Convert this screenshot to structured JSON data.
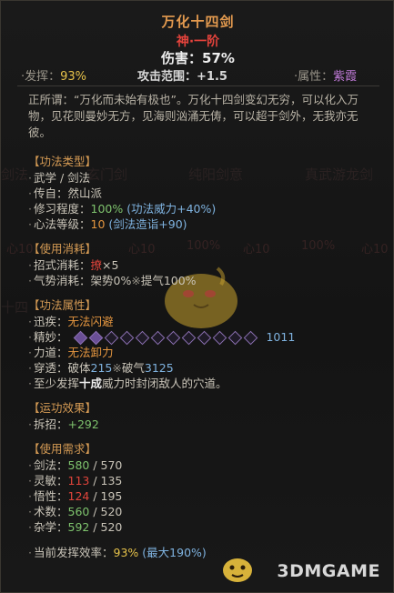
{
  "header": {
    "title": "万化十四剑",
    "rank": "神·一阶",
    "damage_label": "伤害：",
    "damage_value": "57%"
  },
  "stats": {
    "play_label": "·发挥：",
    "play_value": "93%",
    "range_label": "攻击范围：",
    "range_value": "+1.5",
    "attr_label": "·属性：",
    "attr_value": "紫霞"
  },
  "description": "正所谓：“万化而未始有极也”。万化十四剑变幻无穷，可以化入万物，见花则曼妙无方，见海则汹涌无俦，可以超于剑外，无我亦无彼。",
  "sections": {
    "type_title": "【功法类型】",
    "type_rows": [
      {
        "label": "武学 / 剑法",
        "value": ""
      },
      {
        "label": "传自：",
        "value": "然山派"
      },
      {
        "label": "修习程度：",
        "value": "100%",
        "extra": "(功法威力+40%)"
      },
      {
        "label": "心法等级：",
        "value": "10",
        "extra": "(剑法造诣+90)"
      }
    ],
    "cost_title": "【使用消耗】",
    "cost_row1_label": "招式消耗：",
    "cost_row1_icon": "撩",
    "cost_row1_count": "×5",
    "cost_row2_label": "气势消耗：",
    "cost_row2_a": "架势0%",
    "cost_row2_sep": "※",
    "cost_row2_b": "提气100%",
    "prop_title": "【功法属性】",
    "prop_rows": {
      "swift_label": "迅疾：",
      "swift_value": "无法闪避",
      "fine_label": "精妙：",
      "fine_value": "1011",
      "force_label": "力道：",
      "force_value": "无法卸力",
      "pierce_label": "穿透：",
      "pierce_a_label": "破体",
      "pierce_a_value": "215",
      "pierce_sep": "※",
      "pierce_b_label": "破气",
      "pierce_b_value": "3125",
      "note_a": "至少发挥",
      "note_b": "十成",
      "note_c": "威力时封闭敌人的穴道。"
    },
    "effect_title": "【运功效果】",
    "effect_label": "拆招：",
    "effect_value": "+292",
    "req_title": "【使用需求】",
    "req_rows": [
      {
        "label": "剑法：",
        "have": "580",
        "need": "570"
      },
      {
        "label": "灵敏：",
        "have": "113",
        "need": "135"
      },
      {
        "label": "悟性：",
        "have": "124",
        "need": "195"
      },
      {
        "label": "术数：",
        "have": "560",
        "need": "520"
      },
      {
        "label": "杂学：",
        "have": "592",
        "need": "520"
      }
    ],
    "efficiency_label": "当前发挥效率：",
    "efficiency_value": "93%",
    "efficiency_max": "(最大190%)"
  },
  "background_ghost": {
    "labels": [
      "剑法",
      "玄门剑",
      "纯阳剑意",
      "真武游龙剑",
      "十四"
    ],
    "numbers": [
      "心10",
      "心10",
      "100%",
      "心10",
      "100%",
      "心10"
    ]
  },
  "watermark": "3DMGAME",
  "colors": {
    "title": "#e39a4f",
    "rank": "#e4433c",
    "section": "#d49a54",
    "green": "#7ec36d",
    "blue": "#7fb3e0",
    "red": "#e0443b",
    "purple": "#c07ad8"
  }
}
